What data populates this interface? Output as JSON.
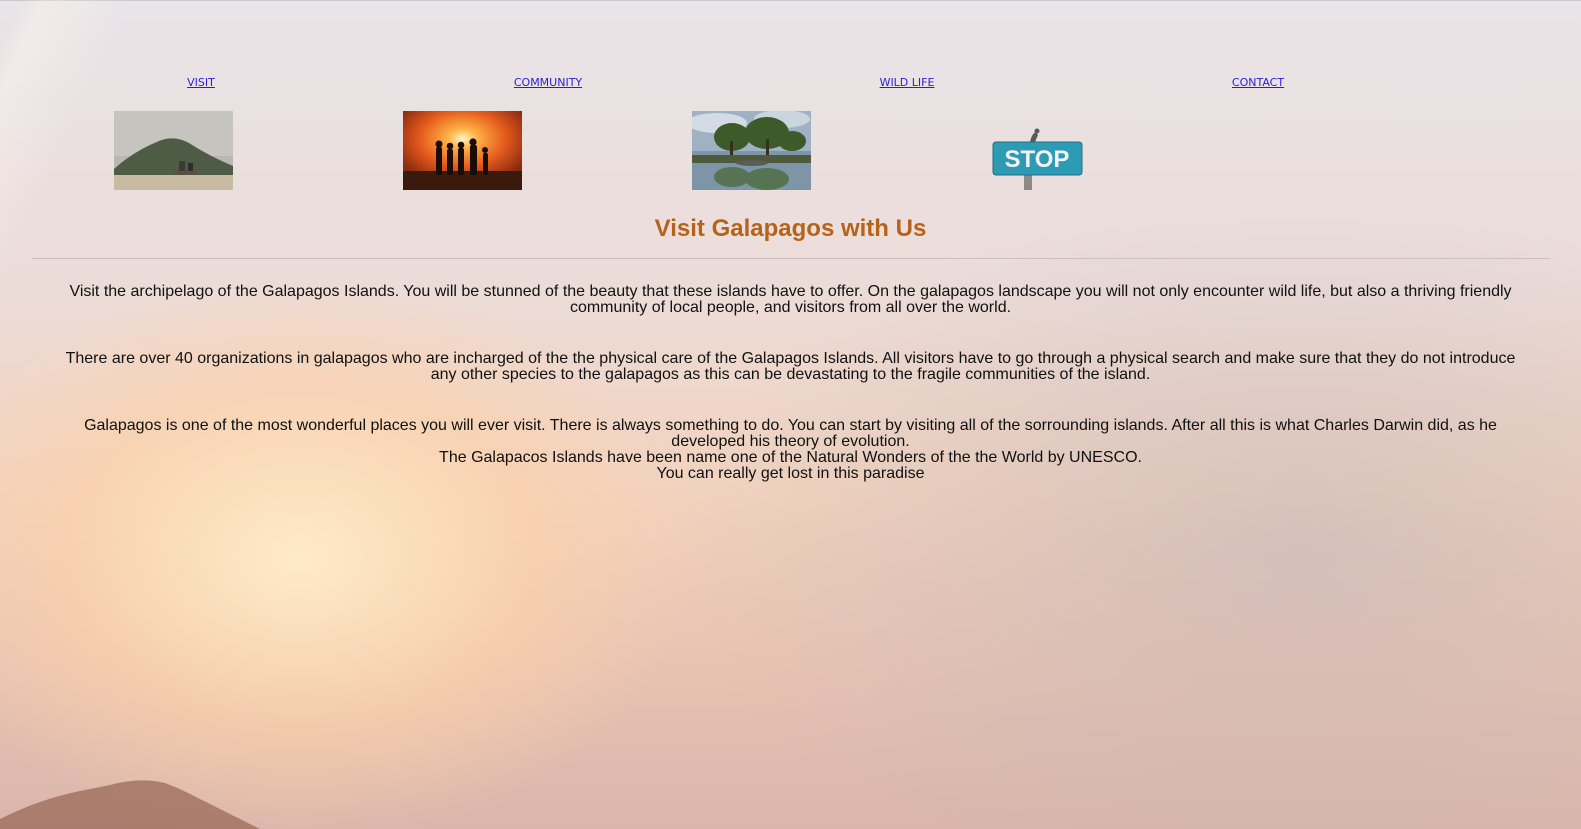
{
  "nav": {
    "items": [
      {
        "label": "VISIT"
      },
      {
        "label": "COMMUNITY"
      },
      {
        "label": "WILD LIFE"
      },
      {
        "label": "CONTACT"
      }
    ]
  },
  "page": {
    "title": "Visit Galapagos with Us"
  },
  "content": {
    "paragraph_1": "Visit the archipelago of the Galapagos Islands. You will be stunned of the beauty that these islands have to offer. On the galapagos landscape you will not only encounter wild life, but also a thriving friendly community of local people, and visitors from all over the world.",
    "paragraph_2": "There are over 40 organizations in galapagos who are incharged of the the physical care of the Galapagos Islands. All visitors have to go through a physical search and make sure that they do not introduce any other species to the galapagos as this can be devastating to the fragile communities of the island.",
    "paragraph_3_line_1": "Galapagos is one of the most wonderful places you will ever visit. There is always something to do. You can start by visiting all of the sorrounding islands. After all this is what Charles Darwin did, as he developed his theory of evolution.",
    "paragraph_3_line_2": "The Galapacos Islands have been name one of the Natural Wonders of the the World by UNESCO.",
    "paragraph_3_line_3": "You can really get lost in this paradise"
  },
  "images": {
    "stop_sign_text": "STOP"
  },
  "colors": {
    "link": "#2a1fcf",
    "title": "#b5631a",
    "text": "#111111"
  }
}
